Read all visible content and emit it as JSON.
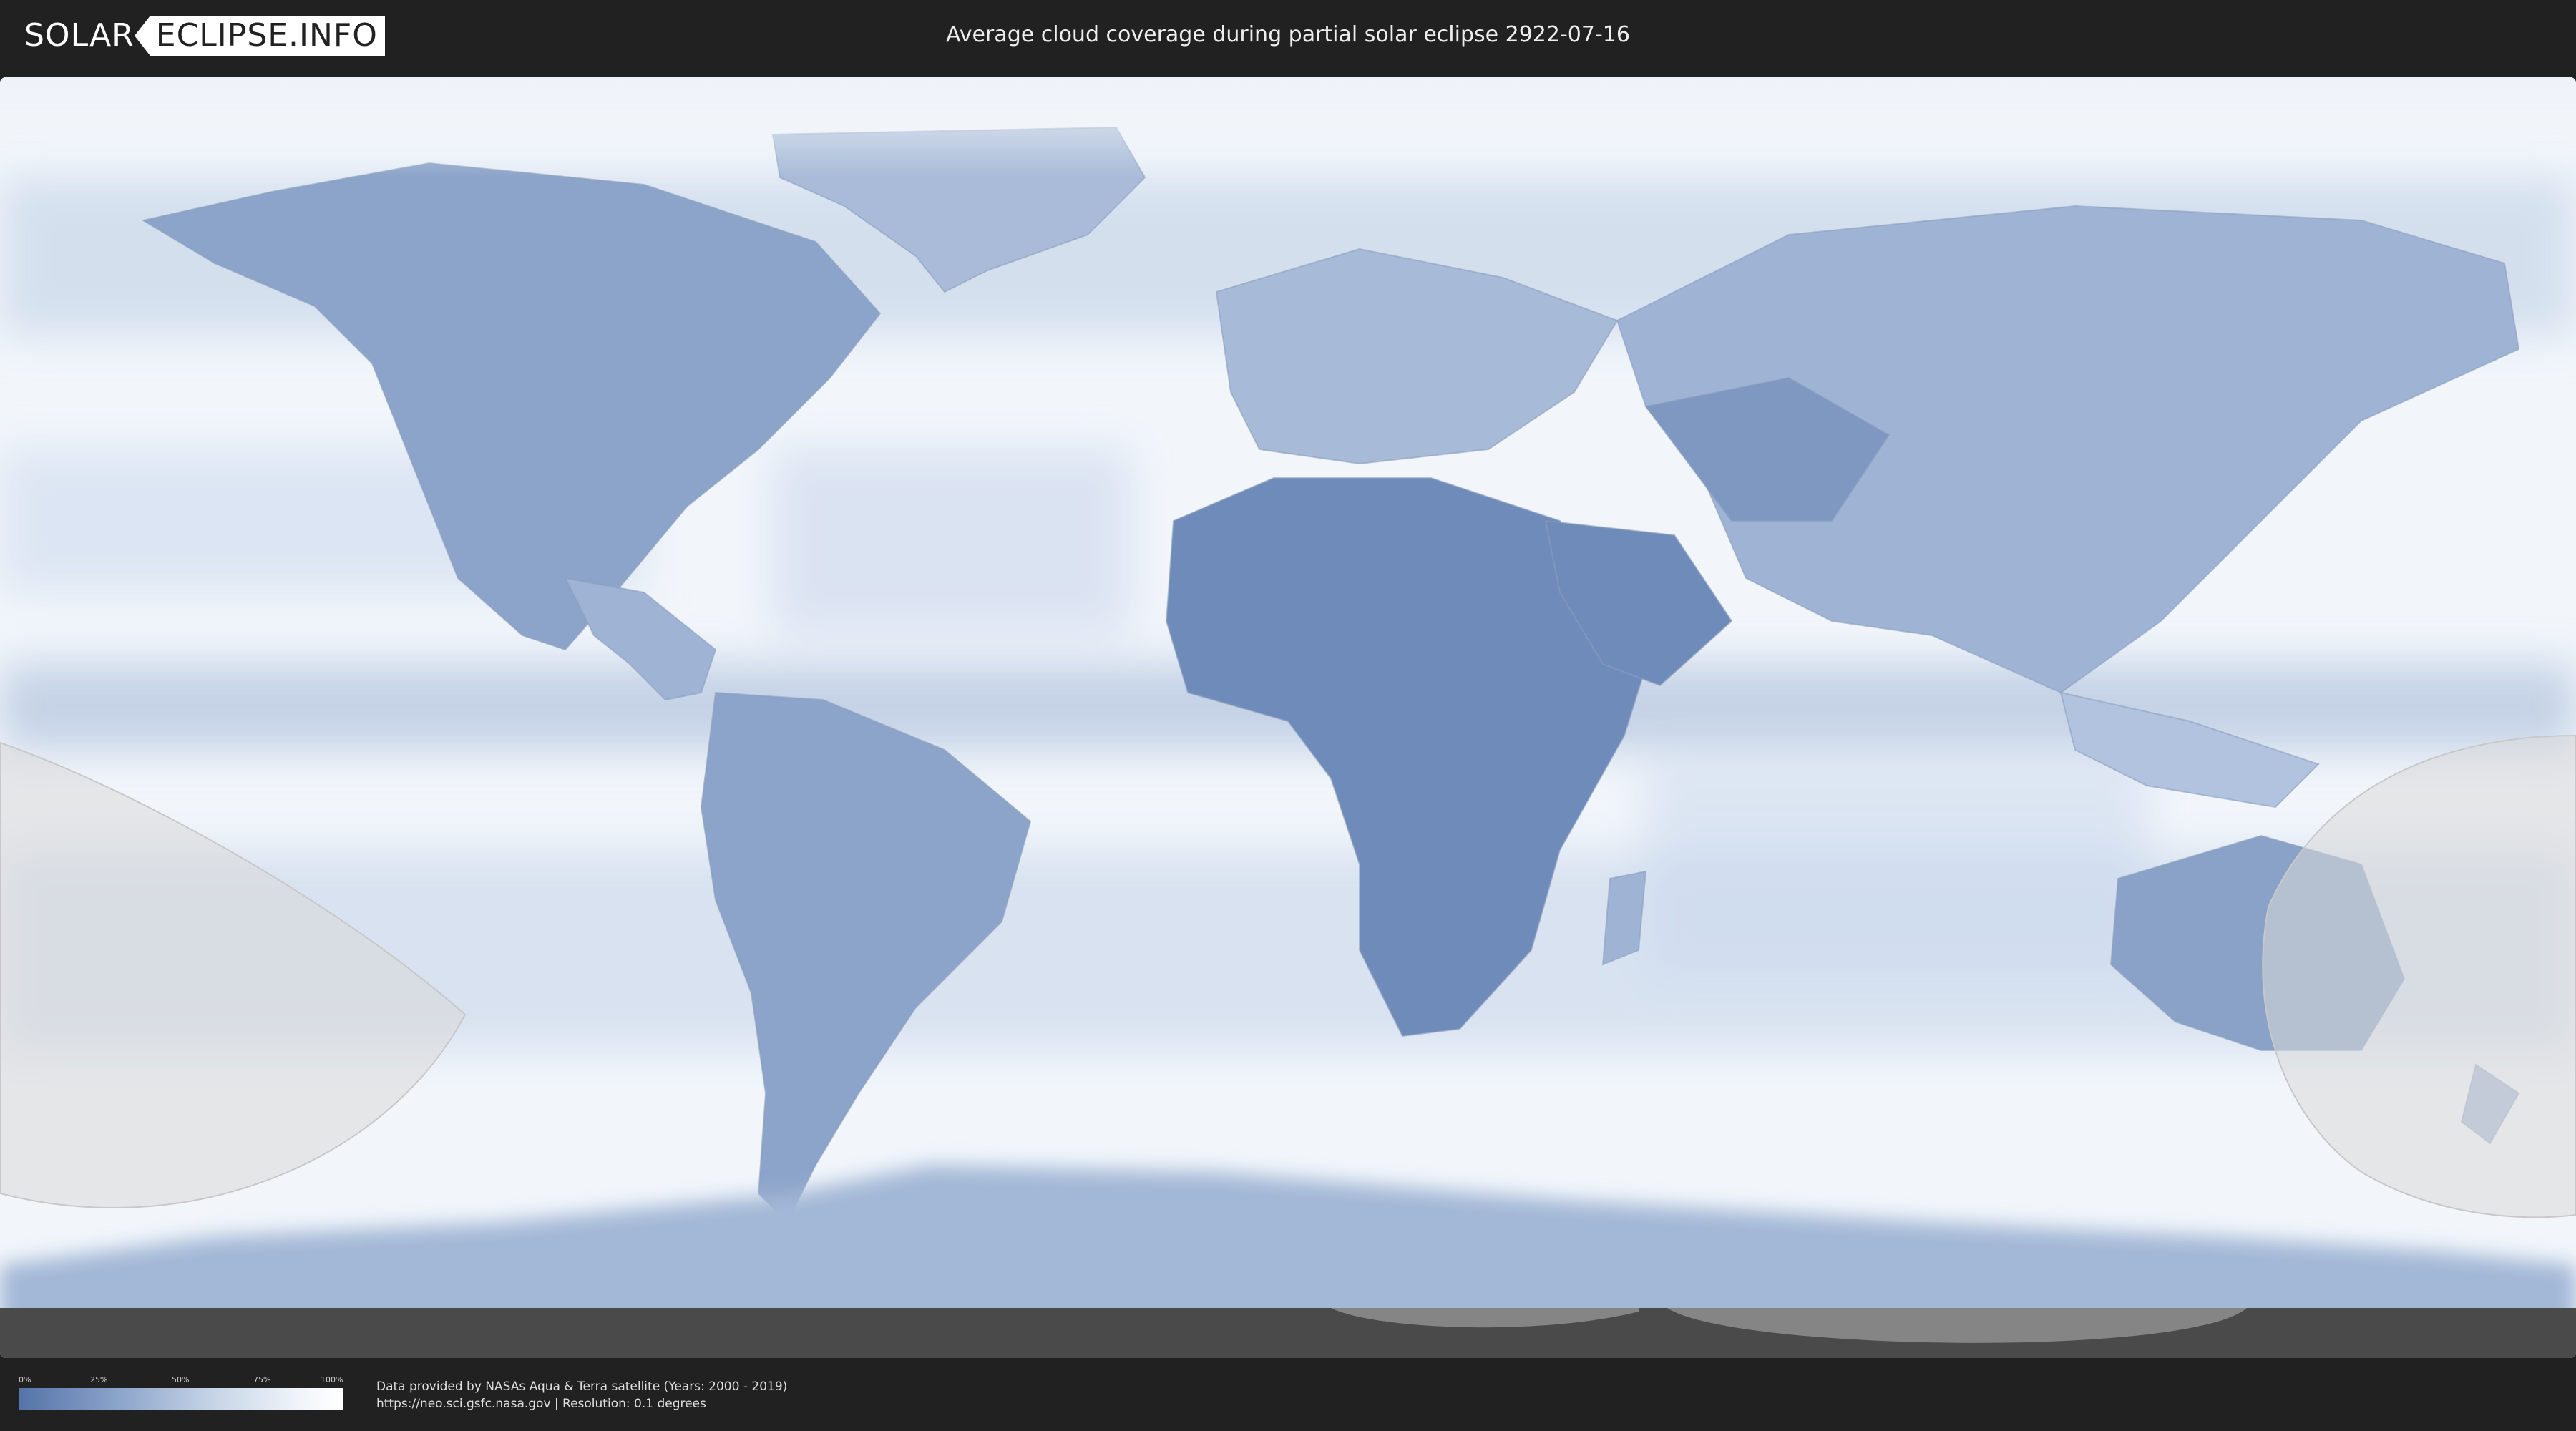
{
  "header": {
    "logo_left": "SOLAR",
    "logo_right": "ECLIPSE.INFO",
    "title": "Average cloud coverage during partial solar eclipse 2922-07-16"
  },
  "map": {
    "colors": {
      "ocean_clear": "#f2f6fb",
      "cloud_light": "#dbe5f1",
      "cloud_mid": "#b5c8e0",
      "cloud_dark": "#6f8bb9",
      "shadow_overlay": "#d8d8d8",
      "night_band": "#4a4a4a"
    }
  },
  "legend": {
    "ticks": [
      "0%",
      "25%",
      "50%",
      "75%",
      "100%"
    ],
    "gradient_start": "#5573a8",
    "gradient_end": "#ffffff"
  },
  "credits": {
    "line1": "Data provided by NASAs Aqua & Terra satellite (Years: 2000 - 2019)",
    "line2": "https://neo.sci.gsfc.nasa.gov | Resolution: 0.1 degrees"
  }
}
